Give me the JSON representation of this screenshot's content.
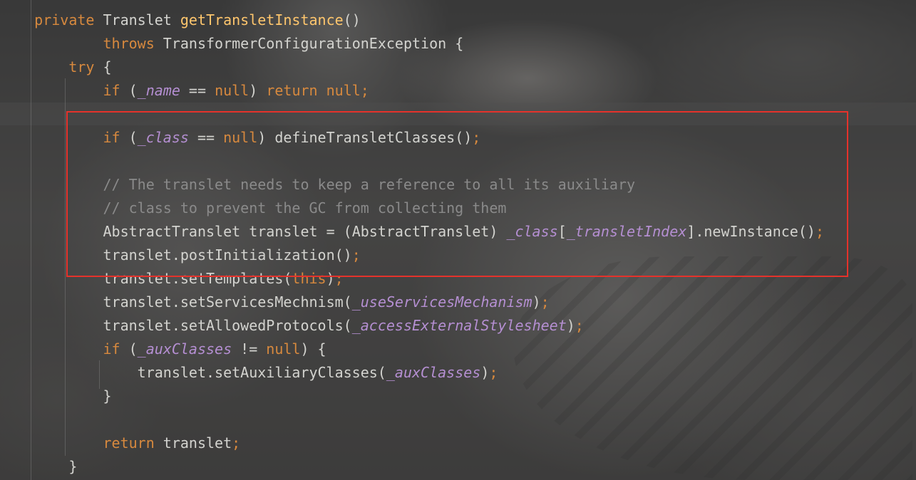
{
  "code_lines": [
    {
      "indent": "",
      "tokens": [
        {
          "t": "private ",
          "c": "kw"
        },
        {
          "t": "Translet ",
          "c": "tx"
        },
        {
          "t": "getTransletInstance",
          "c": "fn"
        },
        {
          "t": "()",
          "c": "tx"
        }
      ]
    },
    {
      "indent": "        ",
      "tokens": [
        {
          "t": "throws ",
          "c": "kw"
        },
        {
          "t": "TransformerConfigurationException {",
          "c": "tx"
        }
      ]
    },
    {
      "indent": "    ",
      "tokens": [
        {
          "t": "try ",
          "c": "kw"
        },
        {
          "t": "{",
          "c": "tx"
        }
      ]
    },
    {
      "indent": "        ",
      "tokens": [
        {
          "t": "if ",
          "c": "kw"
        },
        {
          "t": "(",
          "c": "tx"
        },
        {
          "t": "_name",
          "c": "fld"
        },
        {
          "t": " == ",
          "c": "tx"
        },
        {
          "t": "null",
          "c": "kw"
        },
        {
          "t": ") ",
          "c": "tx"
        },
        {
          "t": "return null",
          "c": "kw"
        },
        {
          "t": ";",
          "c": "kw"
        }
      ]
    },
    {
      "indent": "",
      "tokens": []
    },
    {
      "indent": "        ",
      "tokens": [
        {
          "t": "if ",
          "c": "kw"
        },
        {
          "t": "(",
          "c": "tx"
        },
        {
          "t": "_class",
          "c": "fld"
        },
        {
          "t": " == ",
          "c": "tx"
        },
        {
          "t": "null",
          "c": "kw"
        },
        {
          "t": ") defineTransletClasses()",
          "c": "tx"
        },
        {
          "t": ";",
          "c": "kw"
        }
      ]
    },
    {
      "indent": "",
      "tokens": []
    },
    {
      "indent": "        ",
      "tokens": [
        {
          "t": "// The translet needs to keep a reference to all its auxiliary",
          "c": "cm"
        }
      ]
    },
    {
      "indent": "        ",
      "tokens": [
        {
          "t": "// class to prevent the GC from collecting them",
          "c": "cm"
        }
      ]
    },
    {
      "indent": "        ",
      "tokens": [
        {
          "t": "AbstractTranslet translet = (AbstractTranslet) ",
          "c": "tx"
        },
        {
          "t": "_class",
          "c": "fld"
        },
        {
          "t": "[",
          "c": "tx"
        },
        {
          "t": "_transletIndex",
          "c": "fld"
        },
        {
          "t": "].newInstance()",
          "c": "tx"
        },
        {
          "t": ";",
          "c": "kw"
        }
      ]
    },
    {
      "indent": "        ",
      "tokens": [
        {
          "t": "translet.postInitialization()",
          "c": "tx"
        },
        {
          "t": ";",
          "c": "kw"
        }
      ]
    },
    {
      "indent": "        ",
      "tokens": [
        {
          "t": "translet.setTemplates(",
          "c": "tx"
        },
        {
          "t": "this",
          "c": "kw"
        },
        {
          "t": ")",
          "c": "tx"
        },
        {
          "t": ";",
          "c": "kw"
        }
      ]
    },
    {
      "indent": "        ",
      "tokens": [
        {
          "t": "translet.setServicesMechnism(",
          "c": "tx"
        },
        {
          "t": "_useServicesMechanism",
          "c": "fld"
        },
        {
          "t": ")",
          "c": "tx"
        },
        {
          "t": ";",
          "c": "kw"
        }
      ]
    },
    {
      "indent": "        ",
      "tokens": [
        {
          "t": "translet.setAllowedProtocols(",
          "c": "tx"
        },
        {
          "t": "_accessExternalStylesheet",
          "c": "fld"
        },
        {
          "t": ")",
          "c": "tx"
        },
        {
          "t": ";",
          "c": "kw"
        }
      ]
    },
    {
      "indent": "        ",
      "tokens": [
        {
          "t": "if ",
          "c": "kw"
        },
        {
          "t": "(",
          "c": "tx"
        },
        {
          "t": "_auxClasses",
          "c": "fld"
        },
        {
          "t": " != ",
          "c": "tx"
        },
        {
          "t": "null",
          "c": "kw"
        },
        {
          "t": ") {",
          "c": "tx"
        }
      ]
    },
    {
      "indent": "            ",
      "tokens": [
        {
          "t": "translet.setAuxiliaryClasses(",
          "c": "tx"
        },
        {
          "t": "_auxClasses",
          "c": "fld"
        },
        {
          "t": ")",
          "c": "tx"
        },
        {
          "t": ";",
          "c": "kw"
        }
      ]
    },
    {
      "indent": "        ",
      "tokens": [
        {
          "t": "}",
          "c": "tx"
        }
      ]
    },
    {
      "indent": "",
      "tokens": []
    },
    {
      "indent": "        ",
      "tokens": [
        {
          "t": "return ",
          "c": "kw"
        },
        {
          "t": "translet",
          "c": "tx"
        },
        {
          "t": ";",
          "c": "kw"
        }
      ]
    },
    {
      "indent": "    ",
      "tokens": [
        {
          "t": "}",
          "c": "tx"
        }
      ]
    }
  ],
  "colors": {
    "keyword": "#d7893e",
    "method_declaration": "#ffc66d",
    "field": "#b58fd2",
    "comment": "#8a8a8a",
    "text": "#d3d3cf",
    "highlight_box": "#e5322b"
  }
}
